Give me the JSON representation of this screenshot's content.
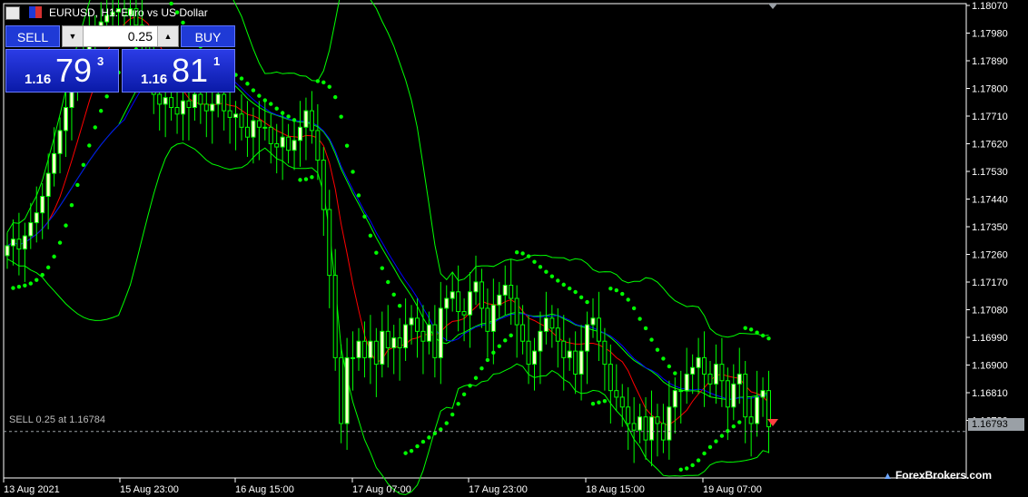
{
  "header": {
    "title": "EURUSD, H1:  Euro vs US Dollar"
  },
  "trade_panel": {
    "sell_label": "SELL",
    "buy_label": "BUY",
    "volume": "0.25",
    "sell_price_small": "1.16",
    "sell_price_big": "79",
    "sell_price_sup": "3",
    "buy_price_small": "1.16",
    "buy_price_big": "81",
    "buy_price_sup": "1"
  },
  "position_line": {
    "label": "SELL 0.25 at 1.16784",
    "price": 1.16784
  },
  "current_price_tag": "1.16793",
  "watermark": "ForexBrokers.com",
  "colors": {
    "background": "#000000",
    "bull_candle": "#ffffcc",
    "bear_candle": "#000000",
    "candle_outline": "#00ff00",
    "ma_red": "#ff0000",
    "ma_blue": "#0000ff",
    "bollinger": "#00ff00",
    "sar": "#00ff00"
  },
  "chart_data": {
    "type": "candlestick",
    "symbol": "EURUSD",
    "timeframe": "H1",
    "y_ticks": [
      "1.18070",
      "1.17980",
      "1.17890",
      "1.17800",
      "1.17710",
      "1.17620",
      "1.17530",
      "1.17440",
      "1.17350",
      "1.17260",
      "1.17170",
      "1.17080",
      "1.16990",
      "1.16900",
      "1.16810",
      "1.16720"
    ],
    "ylim": [
      1.1663,
      1.1808
    ],
    "x_ticks": [
      "13 Aug 2021",
      "15 Aug 23:00",
      "16 Aug 15:00",
      "17 Aug 07:00",
      "17 Aug 23:00",
      "18 Aug 15:00",
      "19 Aug 07:00"
    ],
    "close": [
      1.1734,
      1.1736,
      1.1733,
      1.1737,
      1.1741,
      1.1744,
      1.1749,
      1.1756,
      1.1762,
      1.1769,
      1.1776,
      1.1782,
      1.1788,
      1.1793,
      1.1797,
      1.18,
      1.1802,
      1.1804,
      1.1805,
      1.1806,
      1.1804,
      1.1806,
      1.1801,
      1.1796,
      1.179,
      1.178,
      1.1777,
      1.1779,
      1.1776,
      1.1774,
      1.1778,
      1.1776,
      1.178,
      1.1777,
      1.1775,
      1.1777,
      1.178,
      1.1775,
      1.1773,
      1.1774,
      1.177,
      1.1767,
      1.1772,
      1.177,
      1.177,
      1.1765,
      1.1764,
      1.1767,
      1.1763,
      1.1766,
      1.177,
      1.1775,
      1.1769,
      1.176,
      1.1745,
      1.1725,
      1.17,
      1.168,
      1.17,
      1.17,
      1.1705,
      1.17,
      1.1705,
      1.1698,
      1.1708,
      1.1703,
      1.1706,
      1.1703,
      1.171,
      1.1712,
      1.1708,
      1.1705,
      1.171,
      1.17,
      1.1715,
      1.1718,
      1.172,
      1.1714,
      1.1713,
      1.172,
      1.1723,
      1.1715,
      1.1708,
      1.1716,
      1.1719,
      1.1722,
      1.1718,
      1.171,
      1.1705,
      1.1698,
      1.1702,
      1.1708,
      1.1712,
      1.1709,
      1.1705,
      1.17,
      1.1702,
      1.1695,
      1.1702,
      1.171,
      1.1712,
      1.1705,
      1.1698,
      1.169,
      1.1688,
      1.1685,
      1.168,
      1.1678,
      1.1682,
      1.1675,
      1.1682,
      1.168,
      1.1675,
      1.1685,
      1.169,
      1.169,
      1.1695,
      1.1697,
      1.17,
      1.1695,
      1.1692,
      1.1698,
      1.1693,
      1.1685,
      1.1692,
      1.1695,
      1.1682,
      1.168,
      1.1688,
      1.169,
      1.1679
    ],
    "indicators": [
      "Bollinger Bands",
      "Moving Average (red)",
      "Moving Average (blue)",
      "Parabolic SAR"
    ]
  }
}
